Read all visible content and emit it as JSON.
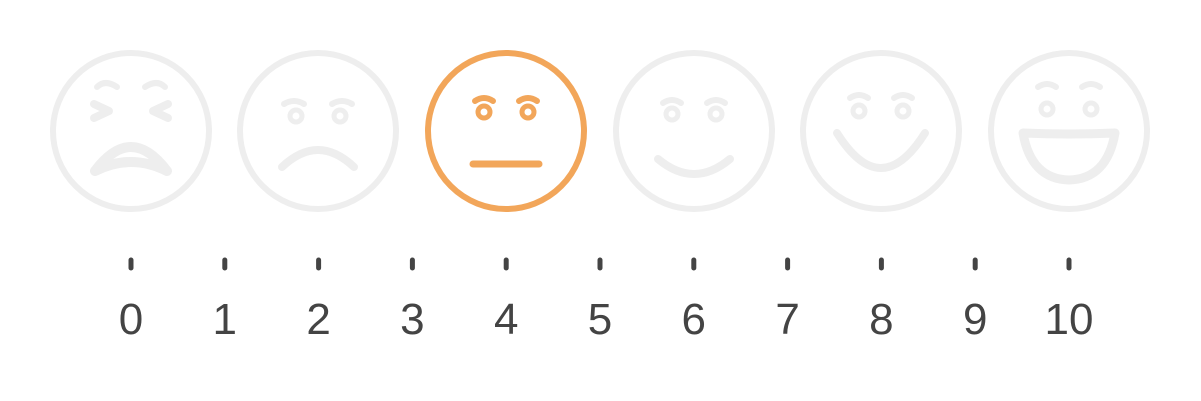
{
  "colors": {
    "inactive": "#eeeeee",
    "active": "#f2a65a",
    "ink": "#444444"
  },
  "selected_face": "neutral",
  "faces": [
    {
      "name": "crying",
      "icon": "crying-face-icon",
      "active": false
    },
    {
      "name": "sad",
      "icon": "sad-face-icon",
      "active": false
    },
    {
      "name": "neutral",
      "icon": "neutral-face-icon",
      "active": true
    },
    {
      "name": "slight-smile",
      "icon": "slight-smile-face-icon",
      "active": false
    },
    {
      "name": "smile",
      "icon": "smile-face-icon",
      "active": false
    },
    {
      "name": "big-smile",
      "icon": "big-smile-face-icon",
      "active": false
    }
  ],
  "scale": {
    "labels": [
      "0",
      "1",
      "2",
      "3",
      "4",
      "5",
      "6",
      "7",
      "8",
      "9",
      "10"
    ]
  }
}
